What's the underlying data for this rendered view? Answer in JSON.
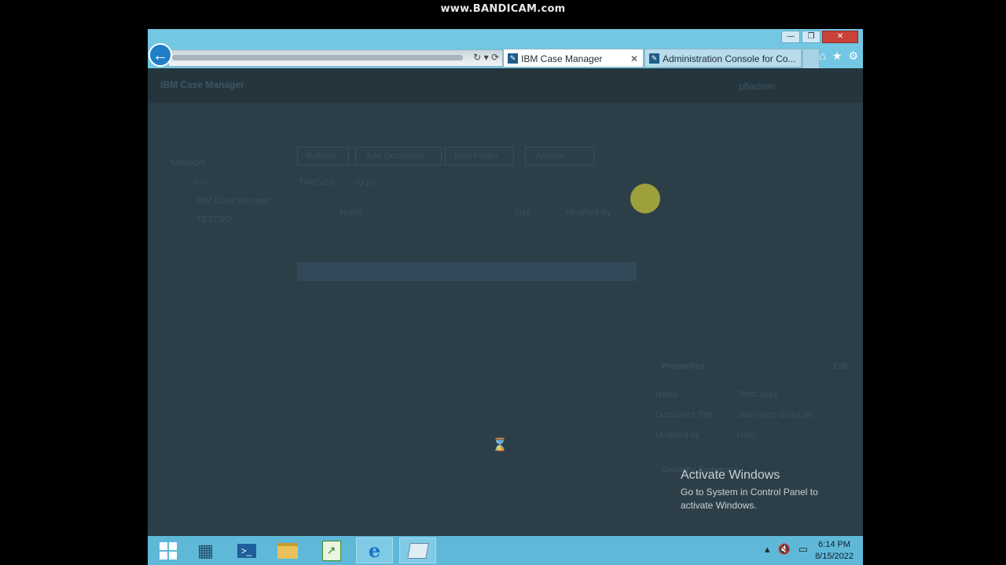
{
  "watermark": "www.BANDICAM.com",
  "browser": {
    "tabs": [
      {
        "title": "IBM Case Manager",
        "active": true
      },
      {
        "title": "Administration Console for Co...",
        "active": false
      }
    ],
    "icons": [
      "back-icon",
      "refresh-icon",
      "home-icon",
      "favorites-icon",
      "settings-icon"
    ]
  },
  "app": {
    "title": "IBM Case Manager",
    "user": "p8admin",
    "tree": [
      "TARGOS",
      "Icm",
      "IBM Case Manager",
      "TESTSO"
    ],
    "toolbar": [
      "Refresh",
      "Add Document",
      "New Folder",
      "Actions"
    ],
    "breadcrumb": [
      "TARGOS",
      "Qury"
    ],
    "columns": [
      "Name",
      "Size",
      "Modified By"
    ],
    "properties_title": "Properties",
    "properties_edit": "Edit",
    "properties": [
      {
        "label": "Name",
        "value": "TestCase1"
      },
      {
        "label": "Document Title",
        "value": "Start-Stop-Script.txt"
      },
      {
        "label": "Modified by",
        "value": "User"
      }
    ],
    "security_title": "Security Summary"
  },
  "activation": {
    "title": "Activate Windows",
    "message": "Go to System in Control Panel to activate Windows."
  },
  "taskbar": {
    "time": "6:14 PM",
    "date": "8/15/2022"
  }
}
